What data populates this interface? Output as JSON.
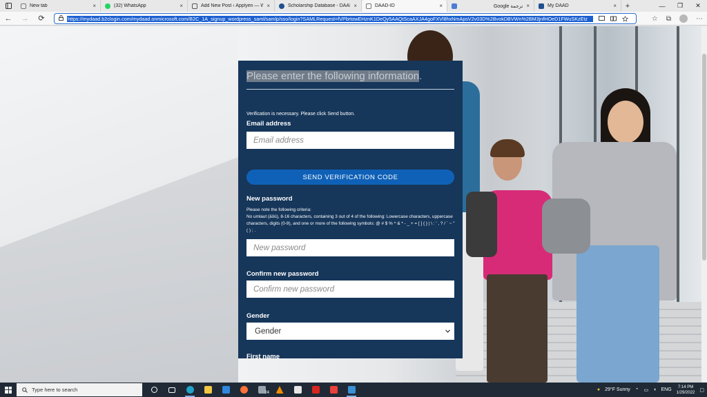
{
  "browser": {
    "tabs": [
      {
        "title": "New tab",
        "favicon_color": "#7a7a7a",
        "active": false
      },
      {
        "title": "(32) WhatsApp",
        "favicon_color": "#25d366",
        "active": false
      },
      {
        "title": "Add New Post ‹ Applyen — Wo",
        "favicon_color": "#555555",
        "active": false
      },
      {
        "title": "Scholarship Database - DAAD -",
        "favicon_color": "#1f4f8f",
        "active": false
      },
      {
        "title": "DAAD-ID",
        "favicon_color": "#777777",
        "active": true
      },
      {
        "title": "Google ترجمة",
        "favicon_color": "#4a7bd6",
        "active": false
      },
      {
        "title": "My DAAD",
        "favicon_color": "#1f4f8f",
        "active": false
      }
    ],
    "close_glyph": "×",
    "new_tab_glyph": "+",
    "window_controls": [
      "—",
      "❐",
      "✕"
    ],
    "url": "https://mydaad.b2clogin.com/mydaad.onmicrosoft.com/B2C_1A_signup_wordpress_saml/samlp/sso/login?SAMLRequest=fVPbrtowEHznK1DeQy5AAQtScaAXJA4goFXVl8hxNmApsV2v03D%2BvokDBVWn%2BM3jnfHOeD1FWuSKzEtz",
    "nav": {
      "back": "←",
      "forward": "→",
      "refresh": "⟳"
    }
  },
  "form": {
    "title_highlighted": "Please enter the following information",
    "title_tail": ".",
    "verification_note": "Verification is necessary. Please click Send button.",
    "email_label": "Email address",
    "email_placeholder": "Email address",
    "send_button": "SEND VERIFICATION CODE",
    "new_password_label": "New password",
    "criteria_heading": "Please note the following criteria:",
    "criteria_text": "No umlaut (äöü), 8-16 characters, containing 3 out of 4 of the following: Lowercase characters, uppercase characters, digits (0-9), and one or more of the following symbols: @ # $ % ^ & * - _ + = [ ] { } | \\ : ' , ? / ` ~ \" ( ) ; .",
    "new_password_placeholder": "New password",
    "confirm_label": "Confirm new password",
    "confirm_placeholder": "Confirm new password",
    "gender_label": "Gender",
    "gender_selected": "Gender",
    "next_label_partial": "First name"
  },
  "taskbar": {
    "search_placeholder": "Type here to search",
    "weather": "29°F  Sunny",
    "language": "ENG",
    "time": "7:14 PM",
    "date": "1/29/2022",
    "app_badge": "24"
  },
  "colors": {
    "form_bg": "#16365a",
    "button_bg": "#0f61b7",
    "accent": "#2a6fd1"
  }
}
